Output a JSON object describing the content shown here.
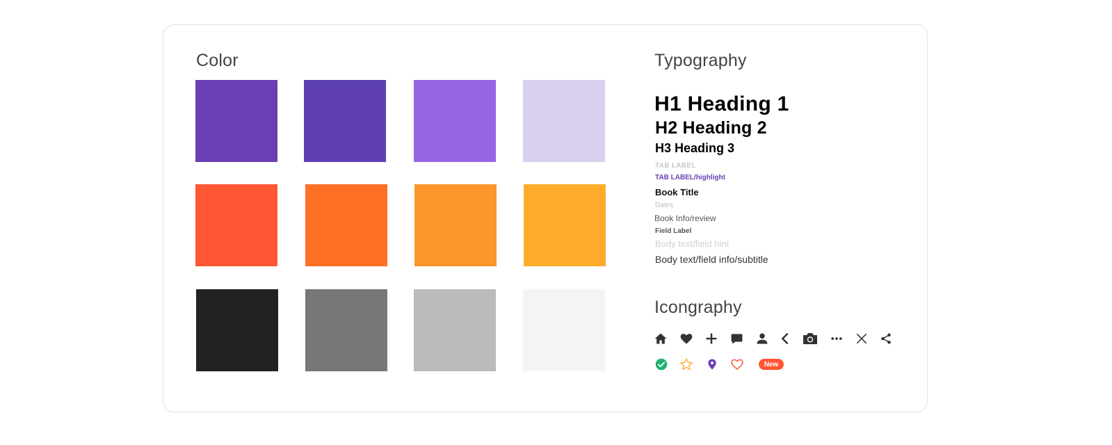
{
  "color": {
    "title": "Color",
    "rows": [
      [
        "#6a3fb4",
        "#5e40b3",
        "#9766e3",
        "#d9cfee"
      ],
      [
        "#ff5733",
        "#ff7026",
        "#fd962b",
        "#feab2b"
      ],
      [
        "#222222",
        "#777777",
        "#bbbbbb",
        "#f4f4f4"
      ]
    ]
  },
  "typography": {
    "title": "Typography",
    "h1": "H1 Heading 1",
    "h2": "H2 Heading 2",
    "h3": "H3 Heading 3",
    "tab_label": "TAB LABEL",
    "tab_label_highlight": "TAB LABEL/highlight",
    "book_title": "Book Title",
    "dates": "Dates",
    "book_info": "Book Info/review",
    "field_label": "Field Label",
    "body_hint": "Body text/field hint",
    "body_info": "Body text/field info/subtitle"
  },
  "iconography": {
    "title": "Icongraphy",
    "row1": [
      "home-icon",
      "heart-icon",
      "plus-icon",
      "chat-bubble-icon",
      "person-icon",
      "chevron-left-icon",
      "camera-icon",
      "more-horizontal-icon",
      "close-icon",
      "share-icon"
    ],
    "row2": [
      "check-circle-icon",
      "star-outline-icon",
      "location-pin-icon",
      "heart-outline-icon"
    ],
    "icon_color": "#333333",
    "status_colors": {
      "check": "#1fb36c",
      "star": "#feab2b",
      "pin": "#6a3fb4",
      "heart": "#ff5733"
    },
    "badge": {
      "label": "New",
      "color": "#ff5733"
    }
  }
}
